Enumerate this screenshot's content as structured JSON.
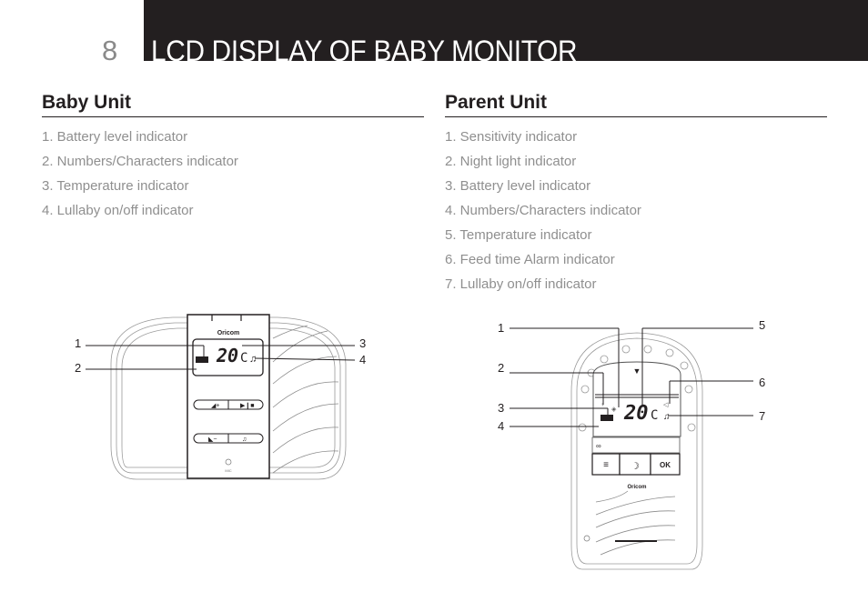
{
  "header": {
    "page_number": "8",
    "title": "LCD DISPLAY OF BABY MONITOR"
  },
  "baby_unit": {
    "heading": "Baby Unit",
    "items": [
      "1. Battery level indicator",
      "2. Numbers/Characters indicator",
      "3. Temperature indicator",
      "4. Lullaby on/off indicator"
    ],
    "diagram": {
      "brand": "Oricom",
      "lcd_temperature": "20",
      "lcd_unit": "C",
      "mic_label": "MIC",
      "callouts": [
        "1",
        "2",
        "3",
        "4"
      ]
    }
  },
  "parent_unit": {
    "heading": "Parent Unit",
    "items": [
      "1. Sensitivity indicator",
      "2. Night light indicator",
      "3. Battery level indicator",
      "4. Numbers/Characters indicator",
      "5. Temperature indicator",
      "6. Feed time Alarm indicator",
      "7. Lullaby on/off indicator"
    ],
    "diagram": {
      "brand": "Oricom",
      "lcd_temperature": "20",
      "lcd_unit": "C",
      "ok_label": "OK",
      "callouts": [
        "1",
        "2",
        "3",
        "4",
        "5",
        "6",
        "7"
      ]
    }
  },
  "colors": {
    "header_bar": "#231f20",
    "body_text": "#8f8f8f",
    "heading_text": "#231f20"
  }
}
